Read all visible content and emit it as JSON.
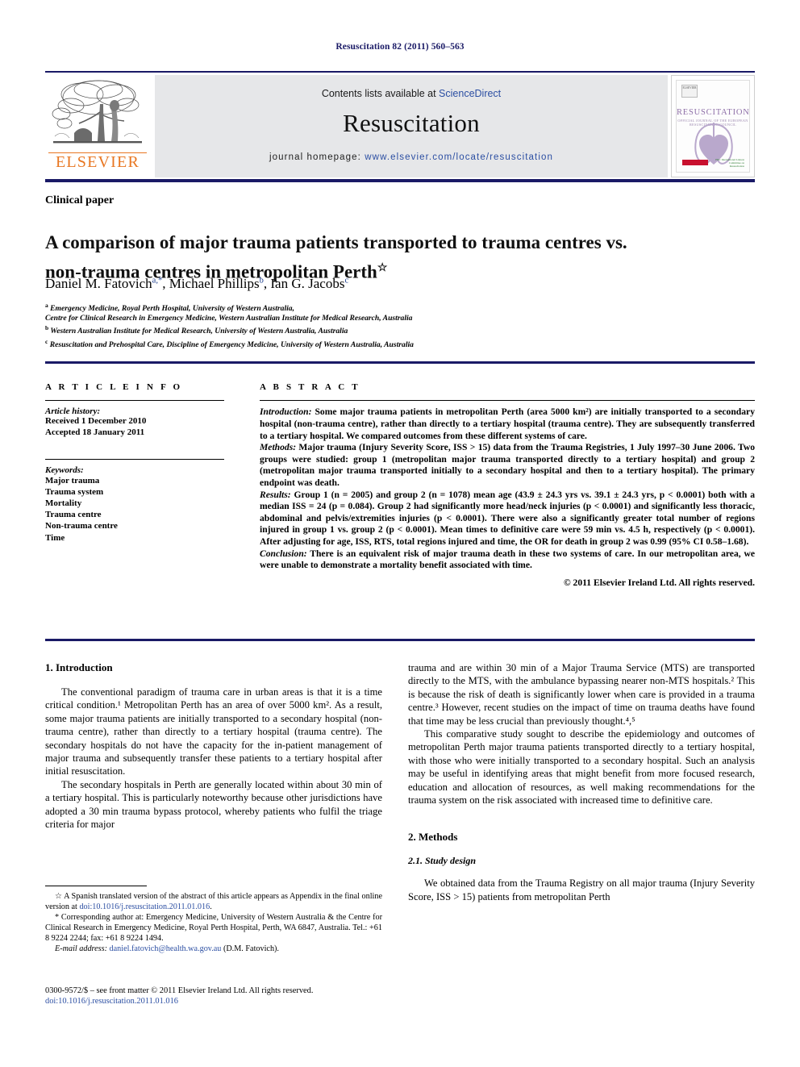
{
  "running_head": "Resuscitation 82 (2011) 560–563",
  "masthead": {
    "publisher_logo_text": "ELSEVIER",
    "contents_prefix": "Contents lists available at ",
    "contents_link": "ScienceDirect",
    "journal_title": "Resuscitation",
    "homepage_prefix": "journal homepage: ",
    "homepage_url": "www.elsevier.com/locate/resuscitation",
    "cover": {
      "title": "RESUSCITATION",
      "subtitle": "OFFICIAL JOURNAL OF THE EUROPEAN RESUSCITATION COUNCIL",
      "badge_text": "ELSEVIER",
      "partner_text": "ERC International Liaison Committee on Resuscitation"
    }
  },
  "article": {
    "kicker": "Clinical paper",
    "title_line1": "A comparison of major trauma patients transported to trauma centres vs.",
    "title_line2": "non-trauma centres in metropolitan Perth",
    "title_marker": "☆",
    "authors": [
      {
        "name": "Daniel M. Fatovich",
        "sup": "a",
        "corresponding": true
      },
      {
        "name": "Michael Phillips",
        "sup": "b",
        "corresponding": false
      },
      {
        "name": "Ian G. Jacobs",
        "sup": "c",
        "corresponding": false
      }
    ],
    "affiliations": [
      {
        "sup": "a",
        "text": "Emergency Medicine, Royal Perth Hospital, University of Western Australia,"
      },
      {
        "sup": "",
        "text": "Centre for Clinical Research in Emergency Medicine, Western Australian Institute for Medical Research, Australia"
      },
      {
        "sup": "b",
        "text": "Western Australian Institute for Medical Research, University of Western Australia, Australia"
      },
      {
        "sup": "c",
        "text": "Resuscitation and Prehospital Care, Discipline of Emergency Medicine, University of Western Australia, Australia"
      }
    ]
  },
  "article_info": {
    "heading": "A R T I C L E    I N F O",
    "history_label": "Article history:",
    "history_lines": [
      "Received 1 December 2010",
      "Accepted 18 January 2011"
    ],
    "keywords_label": "Keywords:",
    "keywords": [
      "Major trauma",
      "Trauma system",
      "Mortality",
      "Trauma centre",
      "Non-trauma centre",
      "Time"
    ]
  },
  "abstract": {
    "heading": "A B S T R A C T",
    "introduction_label": "Introduction:",
    "introduction_text": " Some major trauma patients in metropolitan Perth (area 5000 km²) are initially transported to a secondary hospital (non-trauma centre), rather than directly to a tertiary hospital (trauma centre). They are subsequently transferred to a tertiary hospital. We compared outcomes from these different systems of care.",
    "methods_label": "Methods:",
    "methods_text": " Major trauma (Injury Severity Score, ISS > 15) data from the Trauma Registries, 1 July 1997–30 June 2006. Two groups were studied: group 1 (metropolitan major trauma transported directly to a tertiary hospital) and group 2 (metropolitan major trauma transported initially to a secondary hospital and then to a tertiary hospital). The primary endpoint was death.",
    "results_label": "Results:",
    "results_text": " Group 1 (n = 2005) and group 2 (n = 1078) mean age (43.9 ± 24.3 yrs vs. 39.1 ± 24.3 yrs, p < 0.0001) both with a median ISS = 24 (p = 0.084). Group 2 had significantly more head/neck injuries (p < 0.0001) and significantly less thoracic, abdominal and pelvis/extremities injuries (p < 0.0001). There were also a significantly greater total number of regions injured in group 1 vs. group 2 (p < 0.0001). Mean times to definitive care were 59 min vs. 4.5 h, respectively (p < 0.0001). After adjusting for age, ISS, RTS, total regions injured and time, the OR for death in group 2 was 0.99 (95% CI 0.58–1.68).",
    "conclusion_label": "Conclusion:",
    "conclusion_text": " There is an equivalent risk of major trauma death in these two systems of care. In our metropolitan area, we were unable to demonstrate a mortality benefit associated with time.",
    "copyright": "© 2011 Elsevier Ireland Ltd. All rights reserved."
  },
  "body": {
    "section1_heading": "1.  Introduction",
    "left_p1": "The conventional paradigm of trauma care in urban areas is that it is a time critical condition.¹ Metropolitan Perth has an area of over 5000 km². As a result, some major trauma patients are initially transported to a secondary hospital (non-trauma centre), rather than directly to a tertiary hospital (trauma centre). The secondary hospitals do not have the capacity for the in-patient management of major trauma and subsequently transfer these patients to a tertiary hospital after initial resuscitation.",
    "left_p2": "The secondary hospitals in Perth are generally located within about 30 min of a tertiary hospital. This is particularly noteworthy because other jurisdictions have adopted a 30 min trauma bypass protocol, whereby patients who fulfil the triage criteria for major",
    "right_p1": "trauma and are within 30 min of a Major Trauma Service (MTS) are transported directly to the MTS, with the ambulance bypassing nearer non-MTS hospitals.² This is because the risk of death is significantly lower when care is provided in a trauma centre.³ However, recent studies on the impact of time on trauma deaths have found that time may be less crucial than previously thought.⁴,⁵",
    "right_p2": "This comparative study sought to describe the epidemiology and outcomes of metropolitan Perth major trauma patients transported directly to a tertiary hospital, with those who were initially transported to a secondary hospital. Such an analysis may be useful in identifying areas that might benefit from more focused research, education and allocation of resources, as well making recommendations for the trauma system on the risk associated with increased time to definitive care.",
    "section2_heading": "2.  Methods",
    "subsection21_heading": "2.1.  Study design",
    "right_p3": "We obtained data from the Trauma Registry on all major trauma (Injury Severity Score, ISS > 15) patients from metropolitan Perth"
  },
  "footnotes": {
    "star_marker": "☆",
    "star_text": " A Spanish translated version of the abstract of this article appears as Appendix in the final online version at ",
    "star_doi": "doi:10.1016/j.resuscitation.2011.01.016",
    "star_tail": ".",
    "corr_marker": "*",
    "corr_text": " Corresponding author at: Emergency Medicine, University of Western Australia & the Centre for Clinical Research in Emergency Medicine, Royal Perth Hospital, Perth, WA 6847, Australia. Tel.: +61 8 9224 2244; fax: +61 8 9224 1494.",
    "email_label": "E-mail address:",
    "email": "daniel.fatovich@health.wa.gov.au",
    "email_tail": " (D.M. Fatovich)."
  },
  "imprint": {
    "issn_line": "0300-9572/$ – see front matter © 2011 Elsevier Ireland Ltd. All rights reserved.",
    "doi_label": "doi:",
    "doi_value": "10.1016/j.resuscitation.2011.01.016"
  },
  "colors": {
    "accent_blue": "#1a1a66",
    "link_blue": "#2b4ea2",
    "elsevier_orange": "#e87722",
    "band_grey": "#e6e7e9",
    "cover_purple": "#8e6fa8"
  }
}
